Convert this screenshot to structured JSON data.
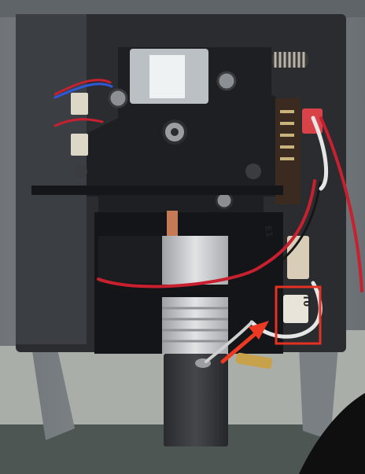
{
  "photo": {
    "subject": "3d-printer-extruder-assembly",
    "colors": {
      "frame_gray": "#7d8286",
      "housing_black": "#1e1f22",
      "heatsink_silver": "#c9cacc",
      "wire_red": "#c8202f",
      "wire_white": "#e6e6e6",
      "connector_beige": "#d9cdb7",
      "connector_red": "#d8434a",
      "pcb_dark": "#3a2a20",
      "highlight_red": "#e33124",
      "arrow_red": "#ec3a22"
    }
  },
  "wire_labels": {
    "upper_tag": "E1",
    "lower_tag": "T0"
  }
}
